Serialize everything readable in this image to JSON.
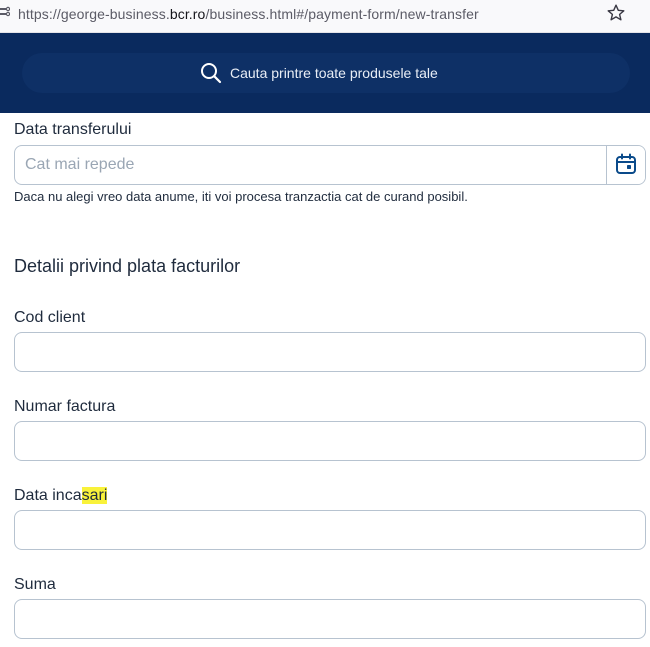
{
  "browser": {
    "url_prefix": "https://george-business.",
    "url_host": "bcr.ro",
    "url_suffix": "/business.html#/payment-form/new-transfer"
  },
  "header": {
    "search_placeholder": "Cauta printre toate produsele tale"
  },
  "form": {
    "transfer_date": {
      "label": "Data transferului",
      "placeholder": "Cat mai repede",
      "hint": "Daca nu alegi vreo data anume, iti voi procesa tranzactia cat de curand posibil."
    },
    "section_title": "Detalii privind plata facturilor",
    "client_code": {
      "label": "Cod client",
      "value": ""
    },
    "invoice_number": {
      "label": "Numar factura",
      "value": ""
    },
    "collection_date": {
      "label_start": "Data inca",
      "label_highlight": "sari",
      "value": ""
    },
    "amount": {
      "label": "Suma",
      "value": ""
    }
  },
  "colors": {
    "header_bg": "#0a2a5e",
    "search_bg": "#0e3066",
    "field_border": "#b7c3d0",
    "highlight": "#f9f23a"
  }
}
